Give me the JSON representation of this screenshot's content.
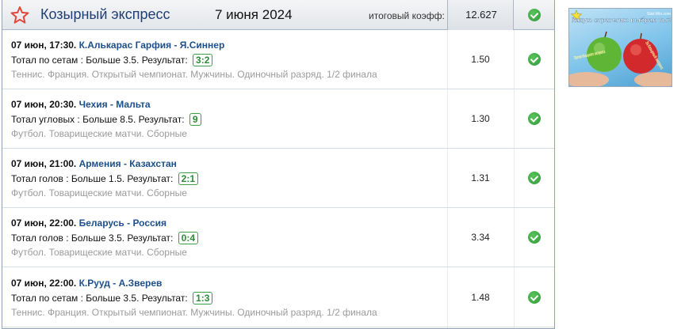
{
  "header": {
    "title": "Козырный экспресс",
    "date": "7 июня 2024",
    "total_coef_label": "итоговый коэфф:",
    "total_coef": "12.627"
  },
  "events": [
    {
      "time": "07 июн, 17:30.",
      "teams": "К.Алькарас Гарфия - Я.Синнер",
      "bet": "Тотал по сетам : Больше 3.5. Результат:",
      "result": "3:2",
      "league": "Теннис. Франция. Открытый чемпионат. Мужчины. Одиночный разряд. 1/2 финала",
      "odd": "1.50"
    },
    {
      "time": "07 июн, 20:30.",
      "teams": "Чехия - Мальта",
      "bet": "Тотал угловых : Больше 8.5. Результат:",
      "result": "9",
      "league": "Футбол. Товарищеские матчи. Сборные",
      "odd": "1.30"
    },
    {
      "time": "07 июн, 21:00.",
      "teams": "Армения - Казахстан",
      "bet": "Тотал голов : Больше 1.5. Результат:",
      "result": "2:1",
      "league": "Футбол. Товарищеские матчи. Сборные",
      "odd": "1.31"
    },
    {
      "time": "07 июн, 22:00.",
      "teams": "Беларусь - Россия",
      "bet": "Тотал голов : Больше 3.5. Результат:",
      "result": "0:4",
      "league": "Футбол. Товарищеские матчи. Сборные",
      "odd": "3.34"
    },
    {
      "time": "07 июн, 22:00.",
      "teams": "К.Рууд - А.Зверев",
      "bet": "Тотал по сетам : Больше 3.5. Результат:",
      "result": "1:3",
      "league": "Теннис. Франция. Открытый чемпионат. Мужчины. Одиночный разряд. 1/2 финала",
      "odd": "1.48"
    }
  ],
  "promo": {
    "site": "Stat-Win.com",
    "question": "Какую стратегию выбрал ты?",
    "left_label": "Против Козырного экспресса",
    "right_label": "За Козырный экспресс"
  },
  "colors": {
    "accent": "#1f3f73",
    "team_link": "#1d4f8a",
    "success": "#2f9a3a",
    "muted": "#9b9b9b",
    "star": "#e0483a"
  },
  "icons": {
    "header": "star-outline-icon",
    "status": "check-circle-icon"
  }
}
